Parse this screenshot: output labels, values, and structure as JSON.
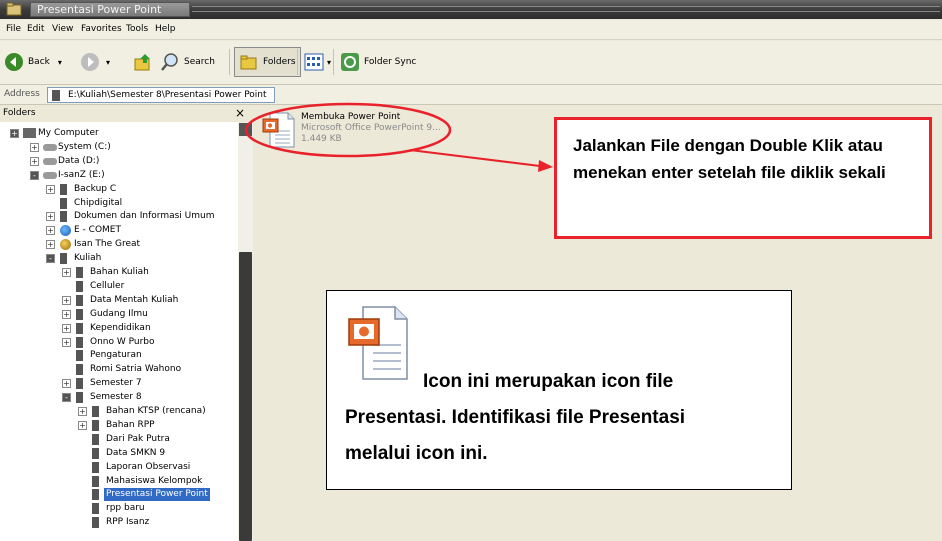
{
  "window": {
    "title": "Presentasi Power Point"
  },
  "menu": [
    "File",
    "Edit",
    "View",
    "Favorites",
    "Tools",
    "Help"
  ],
  "toolbar": {
    "back": "Back",
    "search": "Search",
    "folders": "Folders",
    "folder_sync": "Folder Sync"
  },
  "address": {
    "label": "Address",
    "value": "E:\\Kuliah\\Semester 8\\Presentasi Power Point"
  },
  "folders_pane": {
    "title": "Folders",
    "close": "×"
  },
  "tree": [
    {
      "label": "My Computer",
      "indent": 0,
      "exp": "+",
      "dark": true,
      "icon": "pc"
    },
    {
      "label": "System (C:)",
      "indent": 1,
      "exp": "+",
      "icon": "drive"
    },
    {
      "label": "Data (D:)",
      "indent": 1,
      "exp": "+",
      "icon": "drive"
    },
    {
      "label": "I-sanZ (E:)",
      "indent": 1,
      "exp": "-",
      "dark": true,
      "icon": "drive"
    },
    {
      "label": "Backup C",
      "indent": 2,
      "exp": "+",
      "icon": "folder"
    },
    {
      "label": "Chipdigital",
      "indent": 2,
      "exp": "",
      "icon": "folder"
    },
    {
      "label": "Dokumen dan Informasi Umum",
      "indent": 2,
      "exp": "+",
      "icon": "folder"
    },
    {
      "label": "E - COMET",
      "indent": 2,
      "exp": "+",
      "icon": "globe"
    },
    {
      "label": "Isan The Great",
      "indent": 2,
      "exp": "+",
      "icon": "face"
    },
    {
      "label": "Kuliah",
      "indent": 2,
      "exp": "-",
      "dark": true,
      "icon": "folder"
    },
    {
      "label": "Bahan Kuliah",
      "indent": 3,
      "exp": "+",
      "icon": "folder"
    },
    {
      "label": "Celluler",
      "indent": 3,
      "exp": "",
      "icon": "folder"
    },
    {
      "label": "Data Mentah Kuliah",
      "indent": 3,
      "exp": "+",
      "icon": "folder"
    },
    {
      "label": "Gudang Ilmu",
      "indent": 3,
      "exp": "+",
      "icon": "folder"
    },
    {
      "label": "Kependidikan",
      "indent": 3,
      "exp": "+",
      "icon": "folder"
    },
    {
      "label": "Onno W Purbo",
      "indent": 3,
      "exp": "+",
      "icon": "folder"
    },
    {
      "label": "Pengaturan",
      "indent": 3,
      "exp": "",
      "icon": "folder"
    },
    {
      "label": "Romi Satria Wahono",
      "indent": 3,
      "exp": "",
      "icon": "folder"
    },
    {
      "label": "Semester 7",
      "indent": 3,
      "exp": "+",
      "icon": "folder"
    },
    {
      "label": "Semester 8",
      "indent": 3,
      "exp": "-",
      "dark": true,
      "icon": "folder"
    },
    {
      "label": "Bahan KTSP (rencana)",
      "indent": 4,
      "exp": "+",
      "icon": "folder"
    },
    {
      "label": "Bahan RPP",
      "indent": 4,
      "exp": "+",
      "icon": "folder"
    },
    {
      "label": "Dari Pak Putra",
      "indent": 4,
      "exp": "",
      "icon": "folder"
    },
    {
      "label": "Data SMKN 9",
      "indent": 4,
      "exp": "",
      "icon": "folder"
    },
    {
      "label": "Laporan Observasi",
      "indent": 4,
      "exp": "",
      "icon": "folder"
    },
    {
      "label": "Mahasiswa Kelompok",
      "indent": 4,
      "exp": "",
      "icon": "folder"
    },
    {
      "label": "Presentasi Power Point",
      "indent": 4,
      "exp": "",
      "icon": "folder",
      "selected": true
    },
    {
      "label": "rpp baru",
      "indent": 4,
      "exp": "",
      "icon": "folder"
    },
    {
      "label": "RPP Isanz",
      "indent": 4,
      "exp": "",
      "icon": "folder"
    }
  ],
  "file": {
    "name": "Membuka Power Point",
    "type": "Microsoft Office PowerPoint 9...",
    "size": "1.449 KB"
  },
  "callout": {
    "text": "Jalankan File dengan Double Klik atau menekan enter setelah file diklik sekali"
  },
  "infobox": {
    "line1": "Icon ini merupakan icon file",
    "line2": "Presentasi. Identifikasi file Presentasi",
    "line3": "melalui icon ini."
  },
  "colors": {
    "annotation_red": "#E8212A",
    "selection": "#316AC5"
  }
}
